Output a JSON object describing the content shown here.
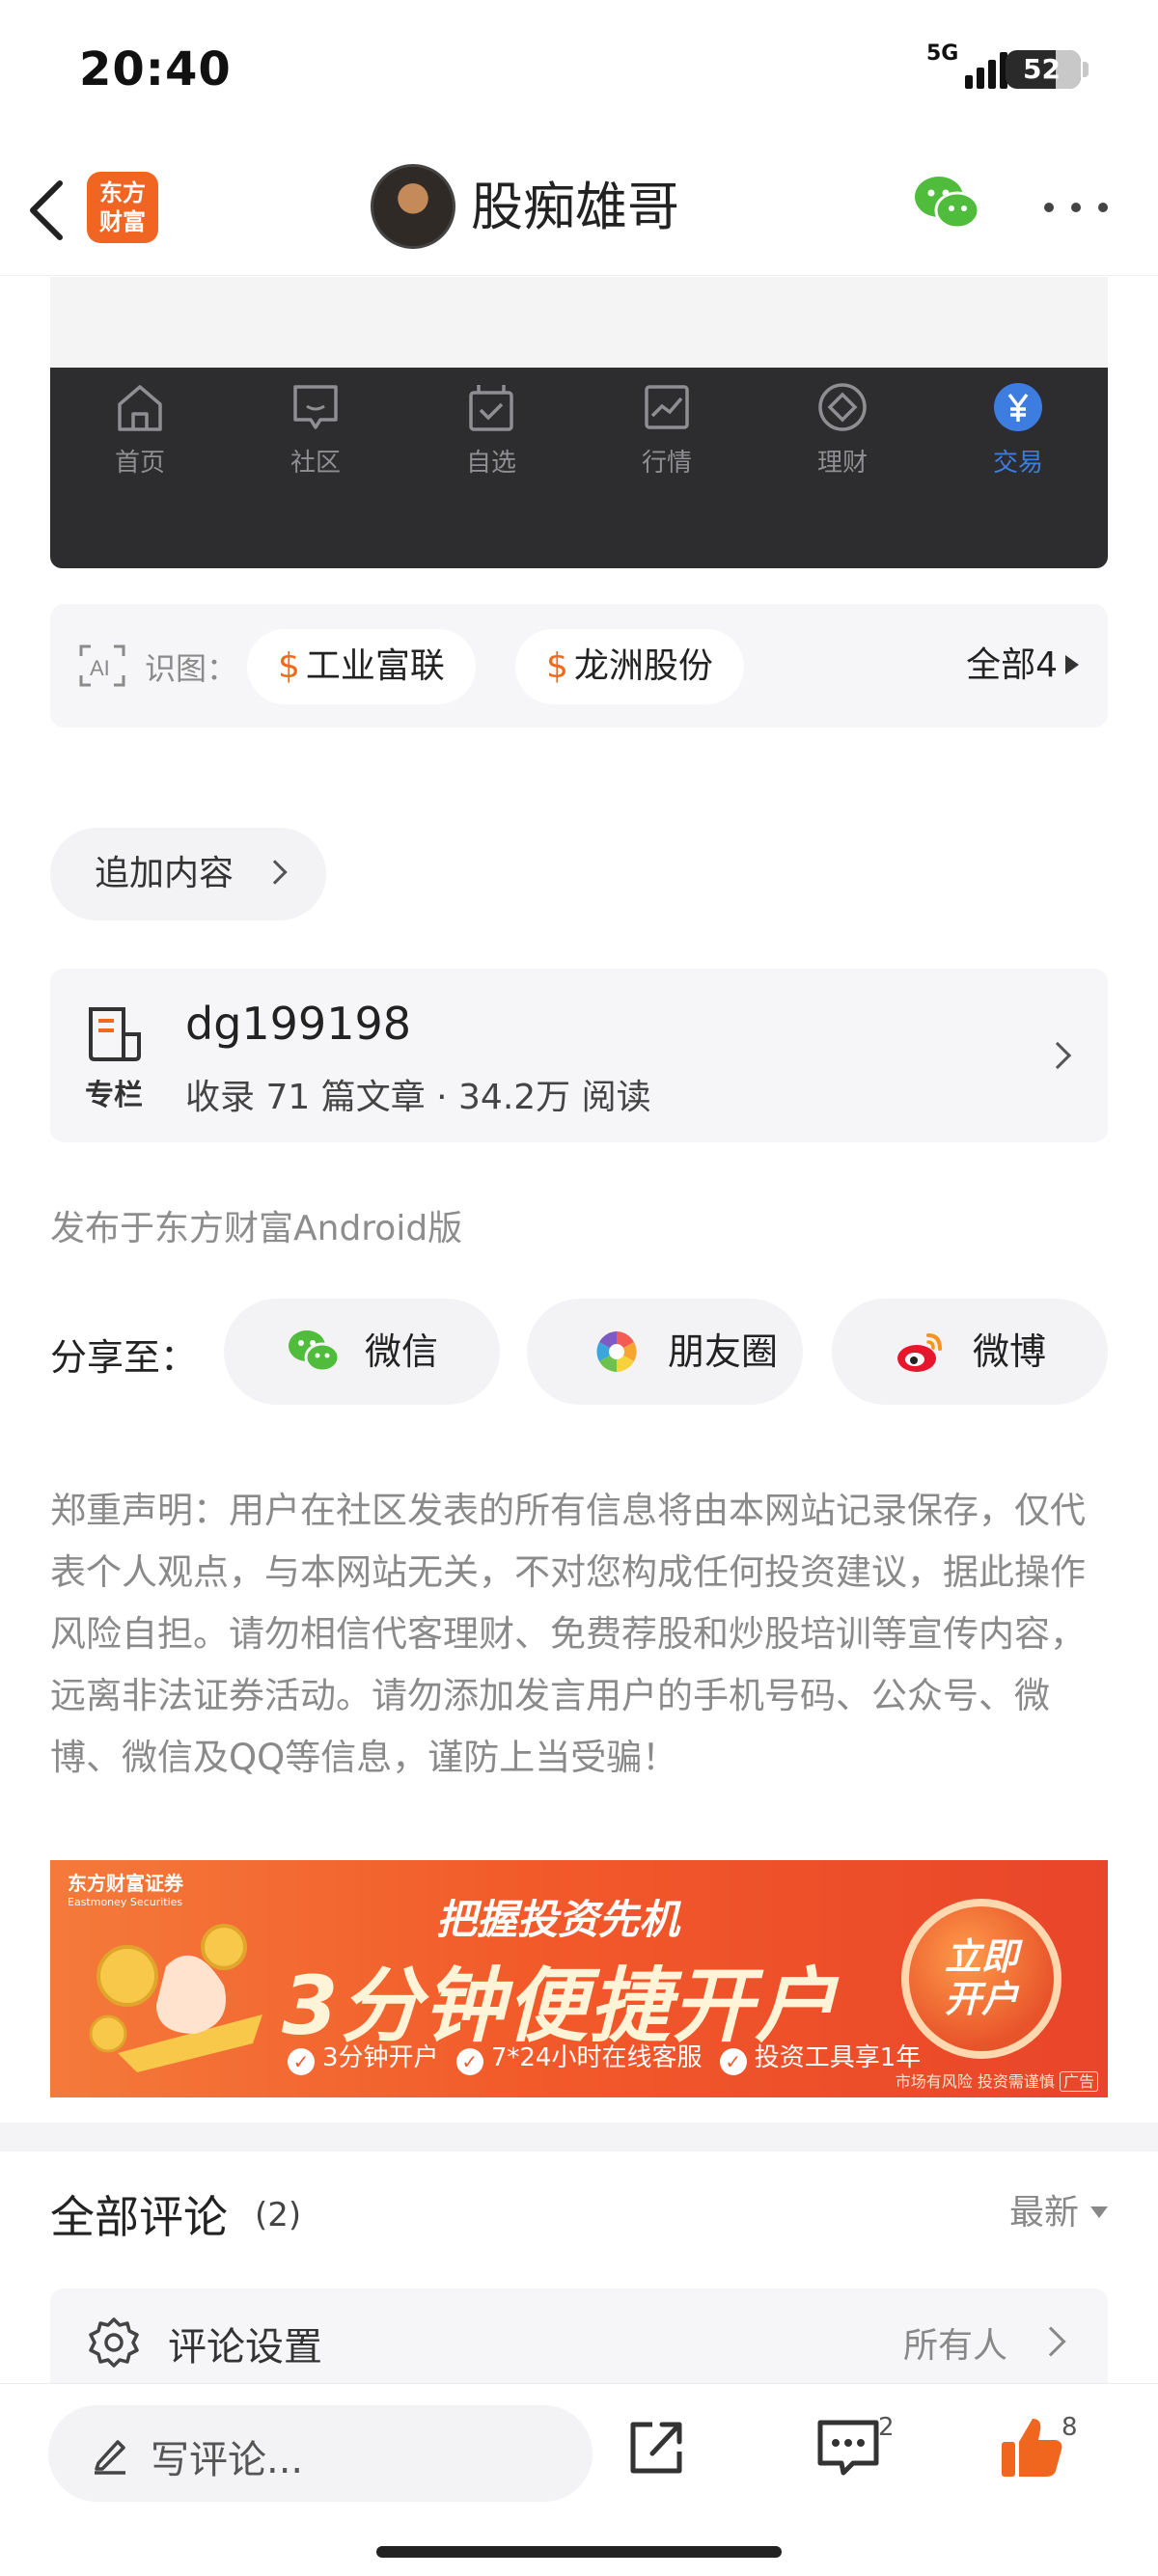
{
  "status_bar": {
    "time": "20:40",
    "network": "5G",
    "battery": "52",
    "battery_level": 0.52
  },
  "header": {
    "back_icon": "chevron-left-icon",
    "app_logo": "东方\n财富",
    "title": "股痴雄哥",
    "share_icon": "wechat-icon",
    "more_icon": "more-icon"
  },
  "embedded_tabbar": {
    "tabs": [
      {
        "label": "首页",
        "icon": "home-icon"
      },
      {
        "label": "社区",
        "icon": "chat-icon"
      },
      {
        "label": "自选",
        "icon": "checklist-icon"
      },
      {
        "label": "行情",
        "icon": "chart-icon"
      },
      {
        "label": "理财",
        "icon": "diamond-icon"
      },
      {
        "label": "交易",
        "icon": "yen-icon",
        "active": true
      }
    ],
    "active_color": "#3d7de0"
  },
  "stocks": {
    "label": "识图：",
    "items": [
      {
        "symbol": "$",
        "name": "工业富联"
      },
      {
        "symbol": "$",
        "name": "龙洲股份"
      }
    ],
    "all_label": "全部4"
  },
  "add_content": {
    "label": "追加内容"
  },
  "column": {
    "icon_label": "专栏",
    "name": "dg199198",
    "meta": "收录 71 篇文章 · 34.2万 阅读"
  },
  "published": "发布于东方财富Android版",
  "share": {
    "label": "分享至：",
    "targets": [
      {
        "label": "微信",
        "icon": "wechat-icon"
      },
      {
        "label": "朋友圈",
        "icon": "moments-icon"
      },
      {
        "label": "微博",
        "icon": "weibo-icon"
      }
    ]
  },
  "disclaimer": "郑重声明：用户在社区发表的所有信息将由本网站记录保存，仅代表个人观点，与本网站无关，不对您构成任何投资建议，据此操作风险自担。请勿相信代客理财、免费荐股和炒股培训等宣传内容，远离非法证券活动。请勿添加发言用户的手机号码、公众号、微博、微信及QQ等信息，谨防上当受骗！",
  "banner": {
    "brand": "东方财富证券",
    "brand_en": "Eastmoney Securities",
    "subtitle": "把握投资先机",
    "headline": "3分钟便捷开户",
    "points": [
      "3分钟开户",
      "7*24小时在线客服",
      "投资工具享1年"
    ],
    "cta": "立即\n开户",
    "risk": "市场有风险 投资需谨慎",
    "ad_tag": "广告"
  },
  "comments": {
    "title": "全部评论",
    "count": "(2)",
    "sort": "最新",
    "settings_label": "评论设置",
    "settings_value": "所有人"
  },
  "toolbar": {
    "write_placeholder": "写评论...",
    "share_icon": "share-out-icon",
    "comment_icon": "comment-icon",
    "comment_count": "2",
    "like_icon": "thumbs-up-icon",
    "like_count": "8"
  },
  "colors": {
    "brand_orange": "#f16522",
    "like_orange": "#f0661e",
    "wechat_green": "#4fbd3b"
  }
}
